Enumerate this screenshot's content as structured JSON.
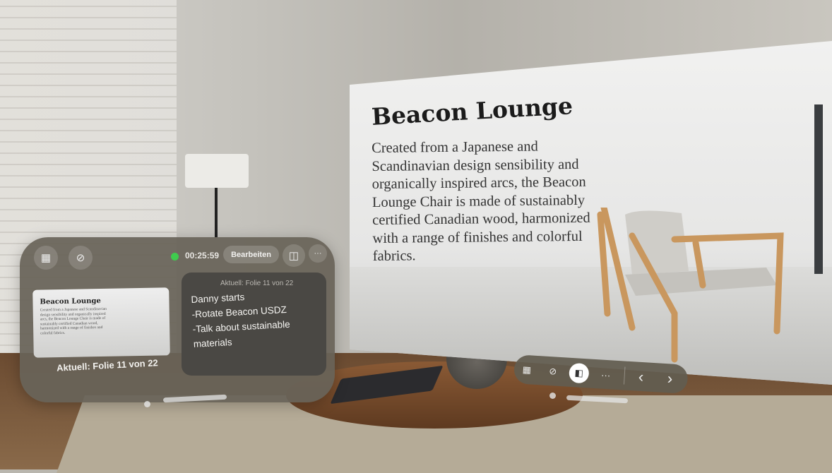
{
  "slide": {
    "title": "Beacon Lounge",
    "body": "Created from a Japanese and Scandinavian design sensibility and organically inspired arcs, the Beacon Lounge Chair is made of sustainably certified Canadian wood, harmonized with a range of finishes and colorful fabrics."
  },
  "presenter": {
    "timer": "00:25:59",
    "timer_status_color": "#3fcb4e",
    "edit_label": "Bearbeiten",
    "thumbnail_caption": "Aktuell: Folie 11 von 22",
    "notes_caption": "Aktuell: Folie 11 von 22",
    "notes": [
      "Danny starts",
      "-Rotate Beacon USDZ",
      "-Talk about sustainable",
      "materials"
    ],
    "icons": [
      "grid-icon",
      "annotate-icon",
      "layout-icon",
      "more-icon"
    ]
  },
  "toolbar": {
    "icons": [
      "grid-icon",
      "annotate-icon",
      "presenter-view-icon",
      "more-icon",
      "chevron-left-icon",
      "chevron-right-icon"
    ],
    "active": "presenter-view-icon",
    "more_label": "···",
    "prev_label": "‹",
    "next_label": "›"
  }
}
